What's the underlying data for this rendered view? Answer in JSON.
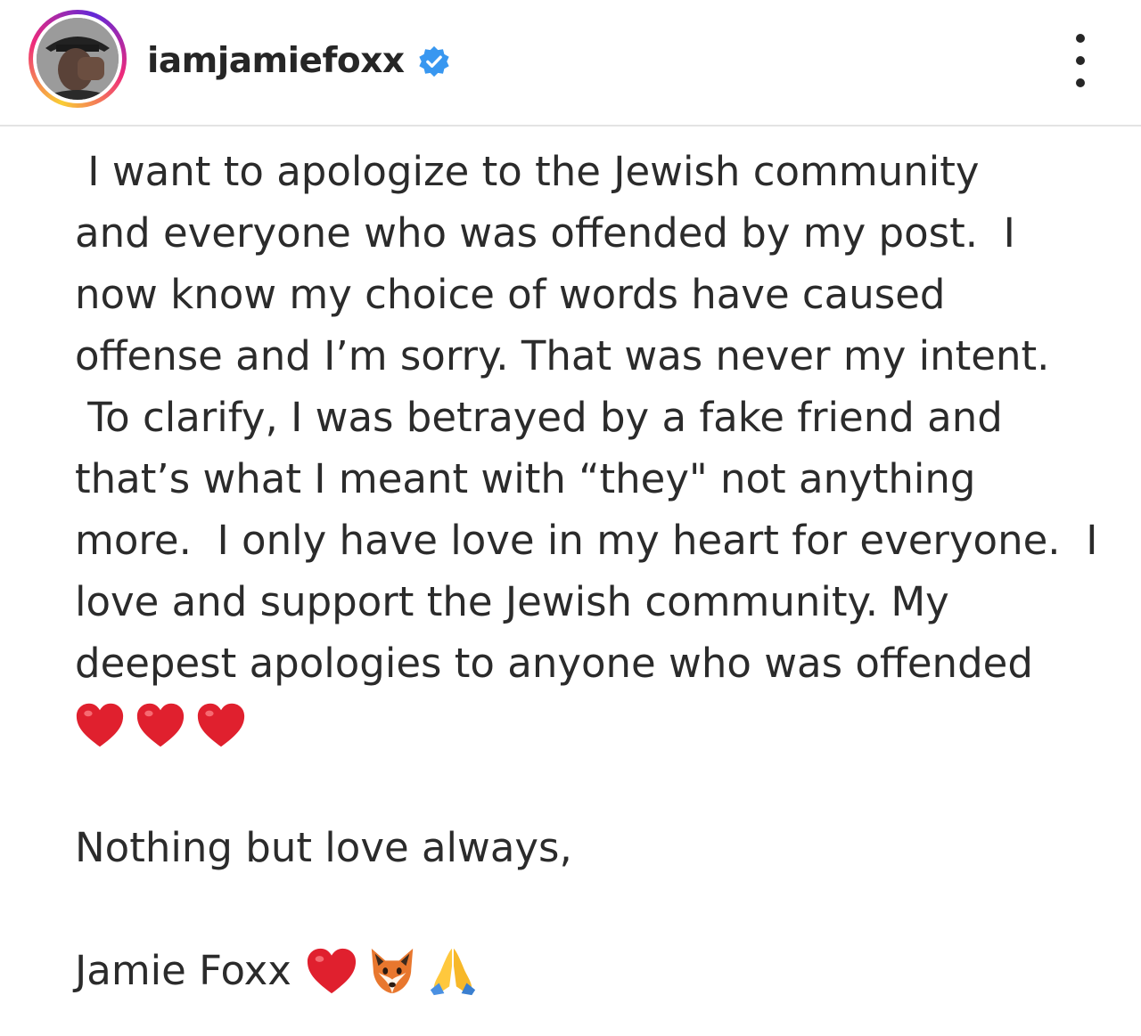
{
  "post": {
    "username": "iamjamiefoxx",
    "lines": [
      " I want to apologize to the Jewish community",
      "and everyone who was offended by my post.  I",
      "now know my choice of words have caused",
      "offense and I’m sorry. That was never my intent.",
      " To clarify, I was betrayed by a fake friend and",
      "that’s what I meant with “they\" not anything",
      "more.  I only have love in my heart for everyone.  I",
      "love and support the Jewish community. My",
      "deepest apologies to anyone who was offended"
    ],
    "closing": "Nothing but love always,",
    "signature": "Jamie Foxx",
    "emojis_after_body": [
      "red-heart",
      "red-heart",
      "red-heart"
    ],
    "emojis_after_signature": [
      "red-heart",
      "fox-face",
      "folded-hands"
    ]
  },
  "colors": {
    "verified_blue": "#3897f0",
    "heart_red": "#e0202e",
    "fox_orange": "#e8772e"
  }
}
